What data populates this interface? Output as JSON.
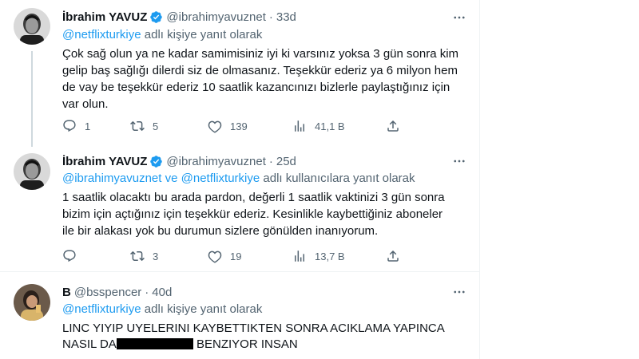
{
  "tweets": [
    {
      "name": "İbrahim YAVUZ",
      "handle": "@ibrahimyavuznet",
      "dot": "·",
      "time": "33d",
      "reply_mentions": [
        "@netflixturkiye"
      ],
      "reply_joiner": "",
      "reply_suffix": " adlı kişiye yanıt olarak",
      "lines": [
        "Çok sağ olun ya ne kadar samimisiniz iyi ki varsınız yoksa 3 gün sonra kim",
        "gelip baş sağlığı dilerdi siz de olmasanız. Teşekkür ederiz ya 6 milyon hem",
        "de vay be teşekkür ederiz 10 saatlik kazancınızı bizlerle paylaştığınız için",
        "var olun."
      ],
      "stats": {
        "replies": "1",
        "retweets": "5",
        "likes": "139",
        "views": "41,1 B"
      }
    },
    {
      "name": "İbrahim YAVUZ",
      "handle": "@ibrahimyavuznet",
      "dot": "·",
      "time": "25d",
      "reply_mentions": [
        "@ibrahimyavuznet",
        "@netflixturkiye"
      ],
      "reply_joiner": " ve ",
      "reply_suffix": " adlı kullanıcılara yanıt olarak",
      "lines": [
        "1 saatlik olacaktı bu arada pardon, değerli 1 saatlik vaktinizi 3 gün sonra",
        "bizim için açtığınız için teşekkür ederiz. Kesinlikle kaybettiğiniz aboneler",
        "ile bir alakası yok bu durumun sizlere gönülden inanıyorum."
      ],
      "stats": {
        "replies": "",
        "retweets": "3",
        "likes": "19",
        "views": "13,7 B"
      }
    },
    {
      "name": "B",
      "handle": "@bsspencer",
      "dot": "·",
      "time": "40d",
      "reply_mentions": [
        "@netflixturkiye"
      ],
      "reply_joiner": "",
      "reply_suffix": " adlı kişiye yanıt olarak",
      "lines": [
        "LINC YIYIP UYELERINI KAYBETTIKTEN SONRA ACIKLAMA YAPINCA"
      ],
      "line2_before": "NASIL DA",
      "line2_after": "BENZIYOR INSAN"
    }
  ],
  "icons": {
    "more": "more-horizontal-icon",
    "verified": "verified-badge-icon",
    "reply": "reply-icon",
    "retweet": "retweet-icon",
    "like": "heart-icon",
    "views": "views-icon",
    "share": "share-icon"
  },
  "colors": {
    "accent": "#1d9bf0",
    "secondary_text": "#536471",
    "primary_text": "#0f1419",
    "thread_line": "#cfd9de"
  }
}
